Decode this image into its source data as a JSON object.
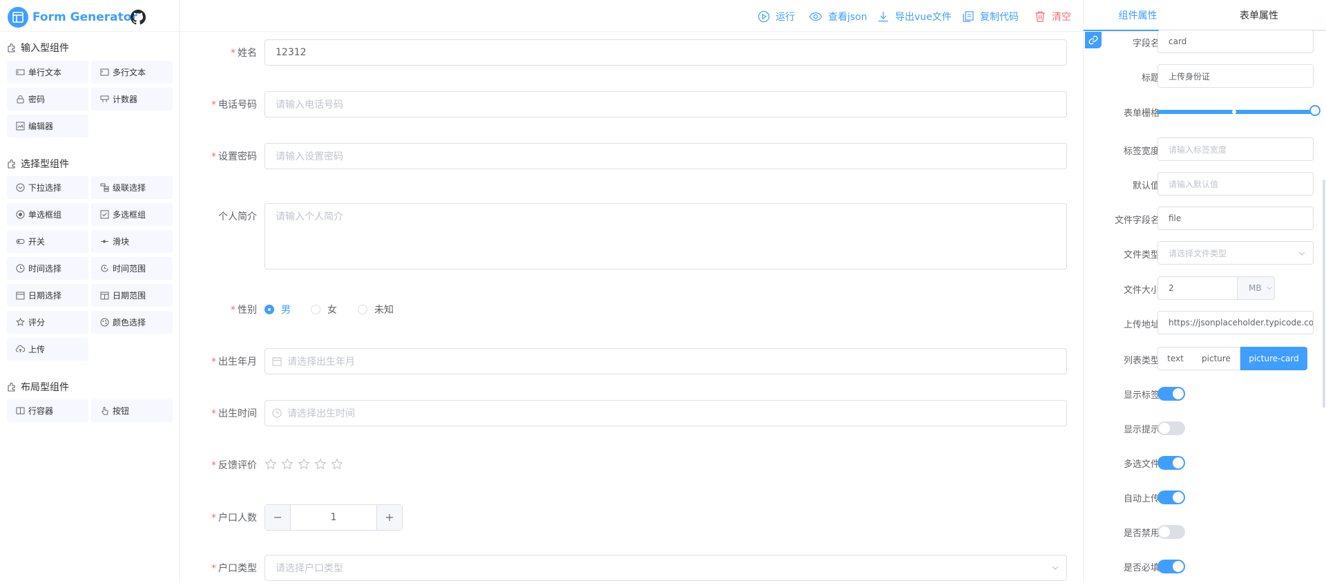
{
  "app": {
    "title": "Form Generator",
    "accent": "#409eff"
  },
  "palette": {
    "groups": [
      {
        "title": "输入型组件",
        "icon": "component-group-icon"
      },
      {
        "title": "选择型组件",
        "icon": "component-group-icon"
      },
      {
        "title": "布局型组件",
        "icon": "component-group-icon"
      }
    ],
    "input_items": [
      {
        "label": "单行文本",
        "icon": "input-icon"
      },
      {
        "label": "多行文本",
        "icon": "textarea-icon"
      },
      {
        "label": "密码",
        "icon": "password-icon"
      },
      {
        "label": "计数器",
        "icon": "number-icon"
      },
      {
        "label": "编辑器",
        "icon": "editor-icon"
      }
    ],
    "select_items": [
      {
        "label": "下拉选择",
        "icon": "select-icon"
      },
      {
        "label": "级联选择",
        "icon": "cascader-icon"
      },
      {
        "label": "单选框组",
        "icon": "radio-icon"
      },
      {
        "label": "多选框组",
        "icon": "checkbox-icon"
      },
      {
        "label": "开关",
        "icon": "switch-icon"
      },
      {
        "label": "滑块",
        "icon": "slider-icon"
      },
      {
        "label": "时间选择",
        "icon": "time-icon"
      },
      {
        "label": "时间范围",
        "icon": "time-range-icon"
      },
      {
        "label": "日期选择",
        "icon": "date-icon"
      },
      {
        "label": "日期范围",
        "icon": "date-range-icon"
      },
      {
        "label": "评分",
        "icon": "rate-icon"
      },
      {
        "label": "颜色选择",
        "icon": "color-icon"
      },
      {
        "label": "上传",
        "icon": "upload-icon"
      }
    ],
    "layout_items": [
      {
        "label": "行容器",
        "icon": "row-icon"
      },
      {
        "label": "按钮",
        "icon": "button-icon"
      }
    ]
  },
  "toolbar": {
    "run": "运行",
    "view_json": "查看json",
    "export_vue": "导出vue文件",
    "copy_code": "复制代码",
    "clear": "清空",
    "danger_color": "#f56c6c"
  },
  "form": {
    "name": {
      "label": "姓名",
      "value": "12312"
    },
    "phone": {
      "label": "电话号码",
      "placeholder": "请输入电话号码"
    },
    "password": {
      "label": "设置密码",
      "placeholder": "请输入设置密码"
    },
    "bio": {
      "label": "个人简介",
      "placeholder": "请输入个人简介"
    },
    "gender": {
      "label": "性别",
      "options": [
        "男",
        "女",
        "未知"
      ],
      "selected": "男"
    },
    "birth_month": {
      "label": "出生年月",
      "placeholder": "请选择出生年月"
    },
    "birth_time": {
      "label": "出生时间",
      "placeholder": "请选择出生时间"
    },
    "feedback": {
      "label": "反馈评价",
      "rating": 0,
      "max": 5
    },
    "household_count": {
      "label": "户口人数",
      "value": "1"
    },
    "household_type": {
      "label": "户口类型",
      "placeholder": "请选择户口类型"
    }
  },
  "props_panel": {
    "tabs": [
      "组件属性",
      "表单属性"
    ],
    "active_tab": "组件属性",
    "field_name": {
      "label": "字段名",
      "value": "card"
    },
    "title": {
      "label": "标题",
      "value": "上传身份证"
    },
    "span": {
      "label": "表单栅格",
      "value": 24,
      "max": 24
    },
    "label_width": {
      "label": "标签宽度",
      "placeholder": "请输入标签宽度"
    },
    "default_value": {
      "label": "默认值",
      "placeholder": "请输入默认值"
    },
    "file_field": {
      "label": "文件字段名",
      "value": "file"
    },
    "file_type": {
      "label": "文件类型",
      "placeholder": "请选择文件类型"
    },
    "file_size": {
      "label": "文件大小",
      "value": "2",
      "unit": "MB"
    },
    "upload_url": {
      "label": "上传地址",
      "value": "https://jsonplaceholder.typicode.com"
    },
    "list_type": {
      "label": "列表类型",
      "options": [
        "text",
        "picture",
        "picture-card"
      ],
      "selected": "picture-card"
    },
    "switches": [
      {
        "label": "显示标签",
        "on": true
      },
      {
        "label": "显示提示",
        "on": false
      },
      {
        "label": "多选文件",
        "on": true
      },
      {
        "label": "自动上传",
        "on": true
      },
      {
        "label": "是否禁用",
        "on": false
      },
      {
        "label": "是否必填",
        "on": true
      }
    ]
  }
}
